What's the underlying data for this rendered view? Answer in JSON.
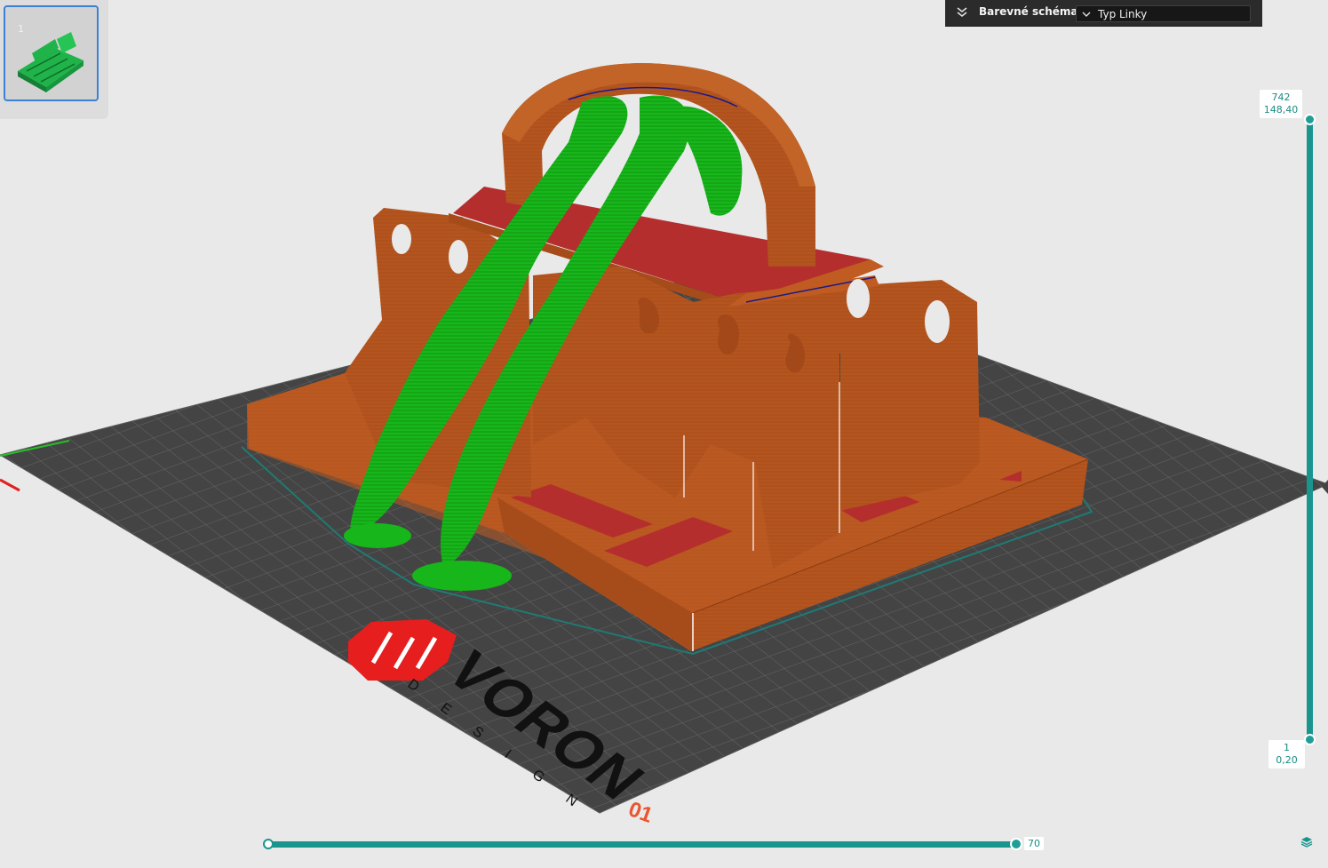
{
  "object_list": {
    "items": [
      {
        "index": "1"
      }
    ]
  },
  "color_panel": {
    "label": "Barevné schéma",
    "selected": "Typ Linky"
  },
  "layer_slider": {
    "top_layer": "742",
    "top_height": "148,40",
    "bottom_layer": "1",
    "bottom_height": "0,20"
  },
  "move_slider": {
    "value": "70",
    "fraction": 1.0
  },
  "bed": {
    "logo_text": "VORON",
    "logo_sub": "DESIGN",
    "plate_number": "01"
  },
  "colors": {
    "accent": "#19958e",
    "wall": "#b4551f",
    "support": "#17b61a",
    "top_skin": "#b52e2e",
    "bed_grid": "#3f3f3f",
    "logo_red": "#e61e1e",
    "panel_bg": "#2b2b2b"
  },
  "icons": {
    "panel_toggle": "double-chevron-down-icon",
    "select_chevron": "chevron-down-icon",
    "layers": "layers-icon"
  }
}
